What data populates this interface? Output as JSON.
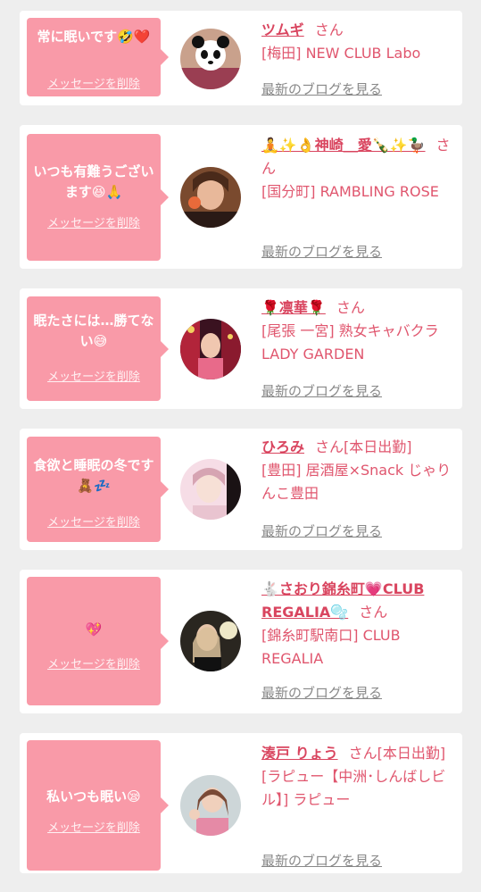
{
  "delete_label": "メッセージを削除",
  "blog_label": "最新のブログを見る",
  "san_label": "さん",
  "items": [
    {
      "message": "常に眠いです🤣❤️",
      "name": "ツムギ",
      "status": "",
      "shop": "[梅田] NEW CLUB Labo",
      "avatar_icon": "panda-avatar"
    },
    {
      "message": "いつも有難うございます😆🙏",
      "name": "🧘✨👌神崎＿愛🍾✨🦆",
      "status": "",
      "shop": "[国分町] RAMBLING ROSE",
      "avatar_icon": "portrait-avatar"
    },
    {
      "message": "眠たさには…勝てない😅",
      "name": "🌹凛華🌹",
      "status": "",
      "shop": "[尾張 一宮] 熟女キャバクラ LADY GARDEN",
      "avatar_icon": "portrait-avatar"
    },
    {
      "message": "食欲と睡眠の冬です🧸💤",
      "name": "ひろみ",
      "status": "[本日出勤]",
      "shop": "[豊田] 居酒屋×Snack じゃりんこ豊田",
      "avatar_icon": "portrait-avatar"
    },
    {
      "message": "💖",
      "name": "🐇さおり錦糸町💗CLUB REGALIA🫧",
      "status": "",
      "shop": "[錦糸町駅南口] CLUB REGALIA",
      "avatar_icon": "portrait-avatar"
    },
    {
      "message": "私いつも眠い😪",
      "name": "湊戸 りょう",
      "status": "[本日出勤]",
      "shop": "[ラピュー【中洲･しんばしビル】] ラピュー",
      "avatar_icon": "portrait-avatar"
    }
  ],
  "colors": {
    "bubble": "#f99aa8",
    "accent": "#d9455f",
    "link": "#888888"
  }
}
